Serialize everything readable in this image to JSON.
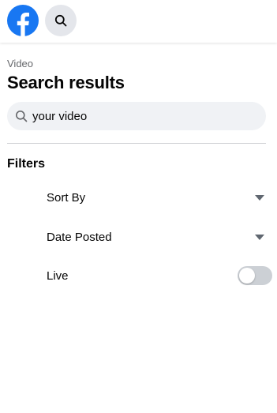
{
  "header": {
    "logo_icon": "facebook-logo-icon",
    "search_icon": "search-icon",
    "brand_color": "#1877f2"
  },
  "panel": {
    "breadcrumb": "Video",
    "title": "Search results",
    "search": {
      "value": "your video",
      "icon": "search-icon"
    },
    "filters": {
      "heading": "Filters",
      "items": [
        {
          "label": "Sort By",
          "control": "dropdown"
        },
        {
          "label": "Date Posted",
          "control": "dropdown"
        },
        {
          "label": "Live",
          "control": "toggle",
          "enabled": false
        }
      ]
    }
  }
}
